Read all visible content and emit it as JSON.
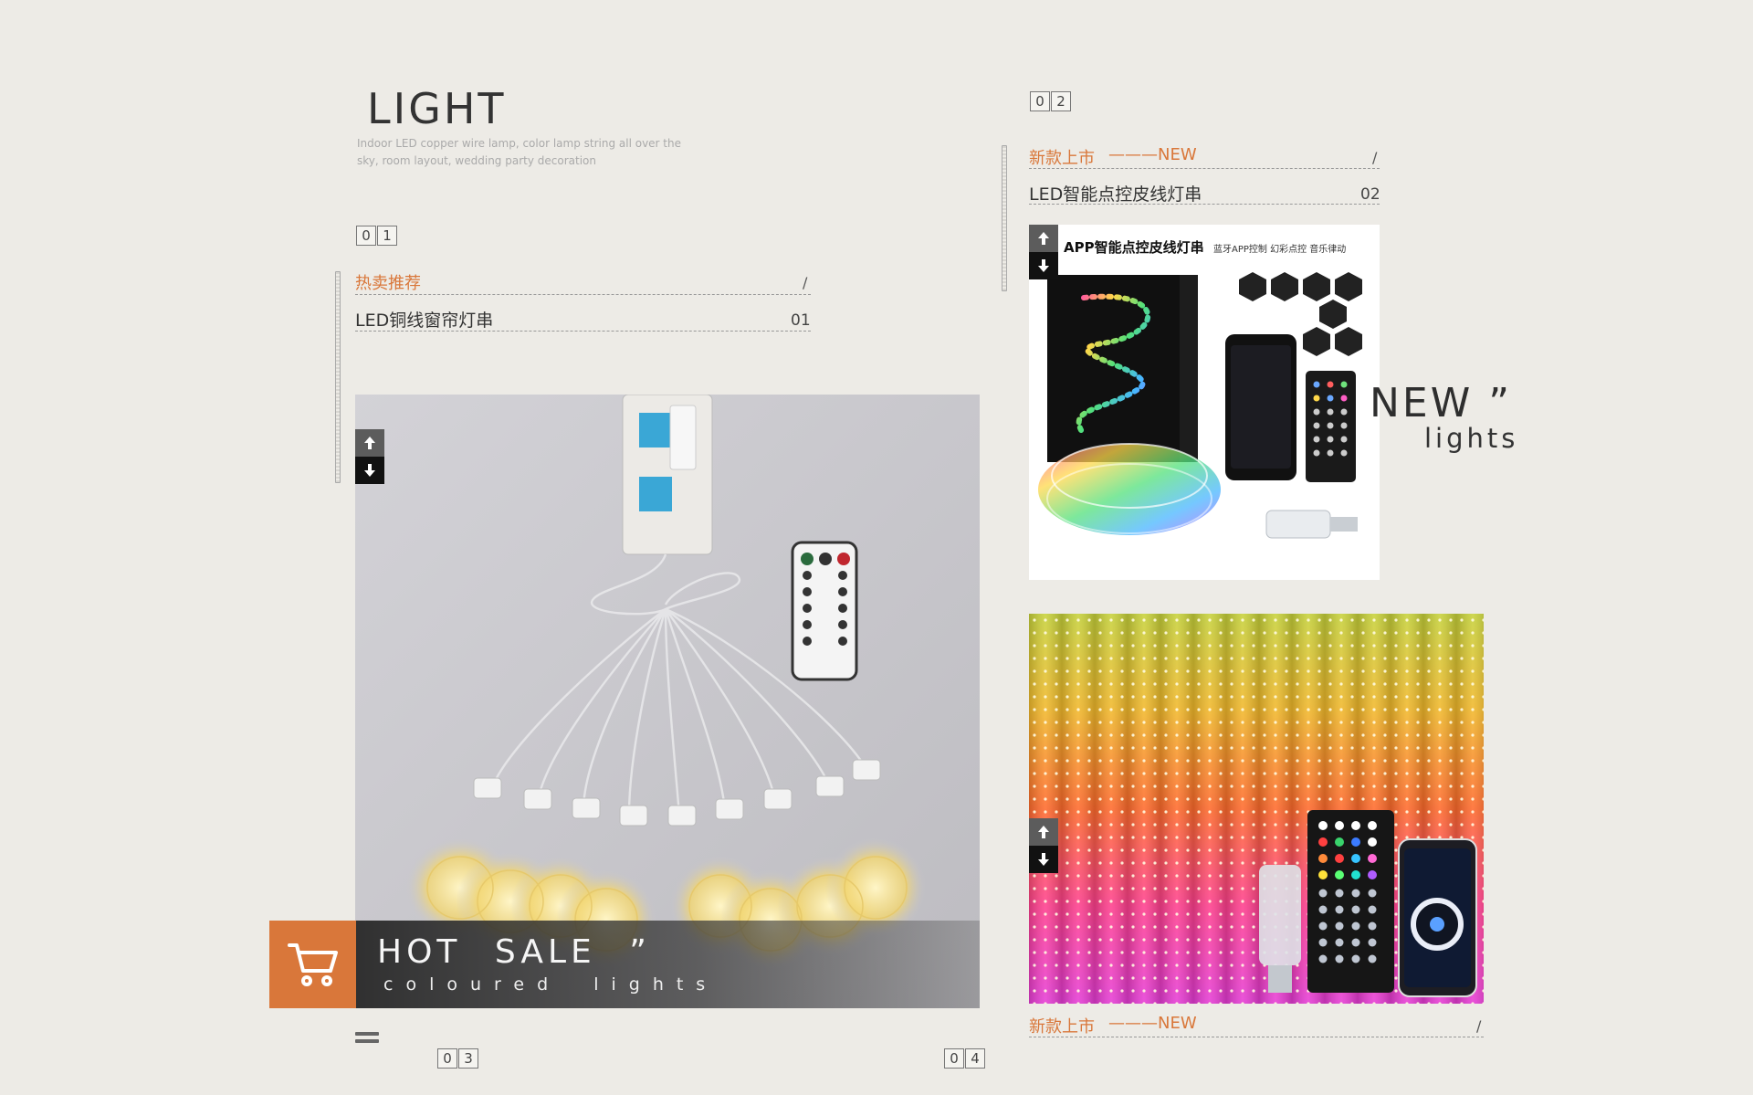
{
  "header": {
    "title": "LIGHT",
    "subtitle": "Indoor LED copper wire lamp, color lamp string all over the sky, room layout, wedding party decoration"
  },
  "section1": {
    "number": [
      "0",
      "1"
    ],
    "category": "热卖推荐",
    "slash": "/",
    "product": "LED铜线窗帘灯串",
    "product_num": "01"
  },
  "section2": {
    "number": [
      "0",
      "2"
    ],
    "category": "新款上市",
    "category_tag": "———NEW",
    "slash": "/",
    "product": "LED智能点控皮线灯串",
    "product_num": "02",
    "image_caption_title": "APP智能点控皮线灯串",
    "image_caption_sub": "蓝牙APP控制 幻彩点控 音乐律动"
  },
  "new_badge": {
    "title": "NEW ”",
    "subtitle": "lights"
  },
  "hot_sale": {
    "title": "HOT SALE ”",
    "subtitle": "coloured lights"
  },
  "section3": {
    "number": [
      "0",
      "3"
    ]
  },
  "section4": {
    "number": [
      "0",
      "4"
    ],
    "category": "新款上市",
    "category_tag": "———NEW",
    "slash": "/"
  },
  "colors": {
    "accent": "#d9773a",
    "background": "#edebe6",
    "text": "#333333"
  },
  "icons": {
    "up": "arrow-up-icon",
    "down": "arrow-down-icon",
    "cart": "shopping-cart-icon",
    "menu": "menu-icon"
  }
}
